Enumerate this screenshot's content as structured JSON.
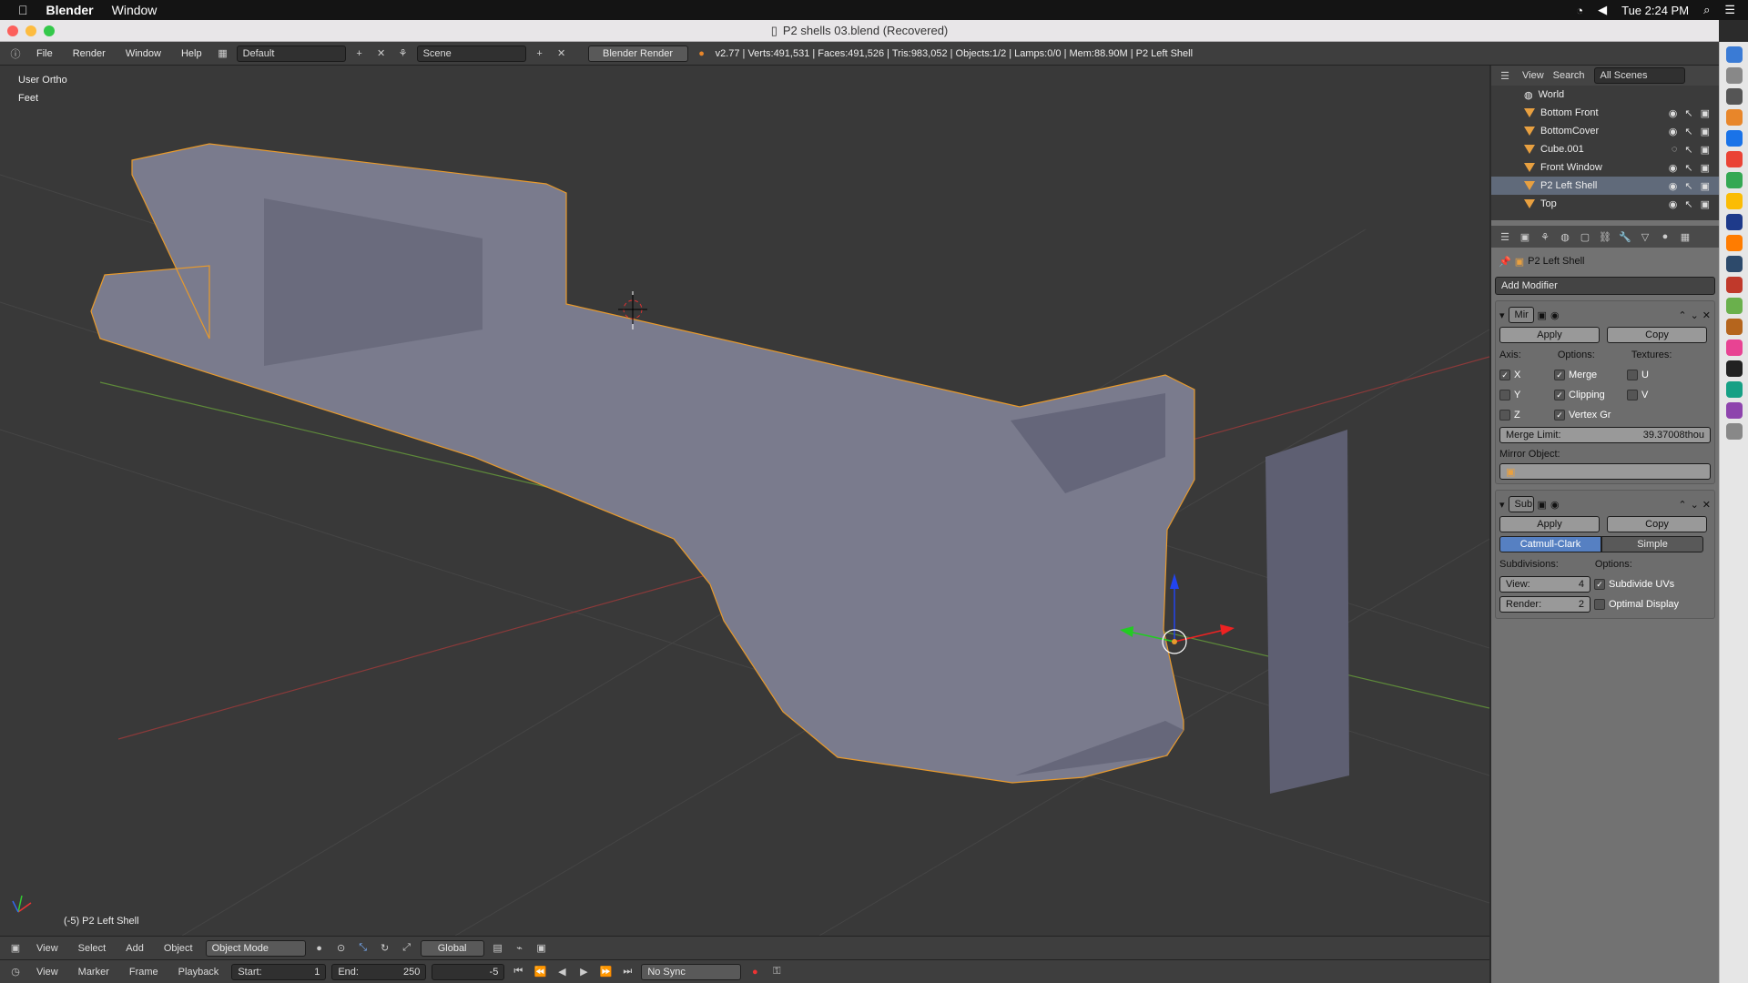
{
  "macbar": {
    "app": "Blender",
    "menu": "Window",
    "time": "Tue 2:24 PM"
  },
  "titlebar": {
    "title": "P2 shells 03.blend (Recovered)"
  },
  "info": {
    "menus": [
      "File",
      "Render",
      "Window",
      "Help"
    ],
    "layout": "Default",
    "scene": "Scene",
    "engine": "Blender Render",
    "stats": "v2.77 | Verts:491,531 | Faces:491,526 | Tris:983,052 | Objects:1/2 | Lamps:0/0 | Mem:88.90M | P2 Left Shell"
  },
  "viewport": {
    "view_name": "User Ortho",
    "units": "Feet",
    "object_label": "(-5) P2 Left Shell"
  },
  "outliner": {
    "menus": [
      "View",
      "Search"
    ],
    "filter": "All Scenes",
    "items": [
      "World",
      "Bottom Front",
      "BottomCover",
      "Cube.001",
      "Front Window",
      "P2 Left Shell",
      "Top"
    ],
    "selected": "P2 Left Shell"
  },
  "props": {
    "object": "P2 Left Shell",
    "add_modifier": "Add Modifier",
    "mirror": {
      "name": "Mir",
      "apply": "Apply",
      "copy": "Copy",
      "axis_label": "Axis:",
      "options_label": "Options:",
      "textures_label": "Textures:",
      "x": "X",
      "y": "Y",
      "z": "Z",
      "merge": "Merge",
      "clipping": "Clipping",
      "vertex_groups": "Vertex Gr",
      "u": "U",
      "v": "V",
      "merge_limit_label": "Merge Limit:",
      "merge_limit": "39.37008thou",
      "mirror_object_label": "Mirror Object:"
    },
    "subsurf": {
      "name": "Sub",
      "apply": "Apply",
      "copy": "Copy",
      "catmull": "Catmull-Clark",
      "simple": "Simple",
      "subdivisions_label": "Subdivisions:",
      "options_label": "Options:",
      "view_label": "View:",
      "view": "4",
      "render_label": "Render:",
      "render": "2",
      "subdivide_uvs": "Subdivide UVs",
      "optimal_display": "Optimal Display"
    }
  },
  "header3d": {
    "menus": [
      "View",
      "Select",
      "Add",
      "Object"
    ],
    "mode": "Object Mode",
    "orientation": "Global"
  },
  "timeline": {
    "menus": [
      "View",
      "Marker",
      "Frame",
      "Playback"
    ],
    "start_label": "Start:",
    "start": "1",
    "end_label": "End:",
    "end": "250",
    "current": "-5",
    "sync": "No Sync"
  },
  "colors": {
    "accent": "#5680c2",
    "selection": "#e89a2c",
    "model": "#7a7b8d"
  }
}
